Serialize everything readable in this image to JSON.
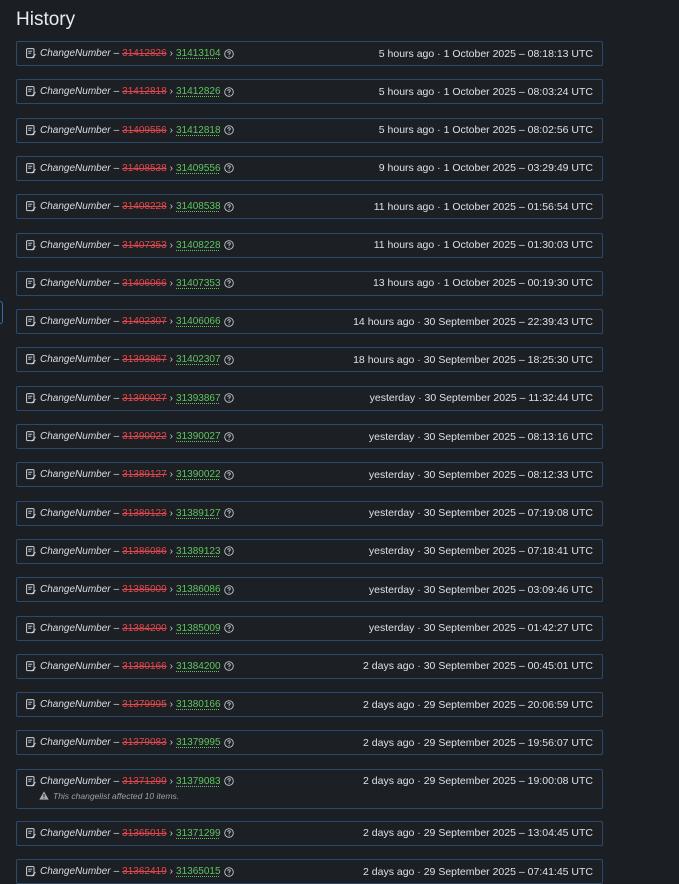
{
  "page": {
    "title": "History"
  },
  "entries": [
    {
      "field": "ChangeNumber",
      "old": "31412826",
      "new": "31413104",
      "time": "5 hours ago · 1 October 2025 – 08:18:13 UTC"
    },
    {
      "field": "ChangeNumber",
      "old": "31412818",
      "new": "31412826",
      "time": "5 hours ago · 1 October 2025 – 08:03:24 UTC"
    },
    {
      "field": "ChangeNumber",
      "old": "31409556",
      "new": "31412818",
      "time": "5 hours ago · 1 October 2025 – 08:02:56 UTC"
    },
    {
      "field": "ChangeNumber",
      "old": "31408538",
      "new": "31409556",
      "time": "9 hours ago · 1 October 2025 – 03:29:49 UTC"
    },
    {
      "field": "ChangeNumber",
      "old": "31408228",
      "new": "31408538",
      "time": "11 hours ago · 1 October 2025 – 01:56:54 UTC"
    },
    {
      "field": "ChangeNumber",
      "old": "31407353",
      "new": "31408228",
      "time": "11 hours ago · 1 October 2025 – 01:30:03 UTC"
    },
    {
      "field": "ChangeNumber",
      "old": "31406066",
      "new": "31407353",
      "time": "13 hours ago · 1 October 2025 – 00:19:30 UTC"
    },
    {
      "field": "ChangeNumber",
      "old": "31402307",
      "new": "31406066",
      "time": "14 hours ago · 30 September 2025 – 22:39:43 UTC"
    },
    {
      "field": "ChangeNumber",
      "old": "31393867",
      "new": "31402307",
      "time": "18 hours ago · 30 September 2025 – 18:25:30 UTC"
    },
    {
      "field": "ChangeNumber",
      "old": "31390027",
      "new": "31393867",
      "time": "yesterday · 30 September 2025 – 11:32:44 UTC"
    },
    {
      "field": "ChangeNumber",
      "old": "31390022",
      "new": "31390027",
      "time": "yesterday · 30 September 2025 – 08:13:16 UTC"
    },
    {
      "field": "ChangeNumber",
      "old": "31389127",
      "new": "31390022",
      "time": "yesterday · 30 September 2025 – 08:12:33 UTC"
    },
    {
      "field": "ChangeNumber",
      "old": "31389123",
      "new": "31389127",
      "time": "yesterday · 30 September 2025 – 07:19:08 UTC"
    },
    {
      "field": "ChangeNumber",
      "old": "31386086",
      "new": "31389123",
      "time": "yesterday · 30 September 2025 – 07:18:41 UTC"
    },
    {
      "field": "ChangeNumber",
      "old": "31385009",
      "new": "31386086",
      "time": "yesterday · 30 September 2025 – 03:09:46 UTC"
    },
    {
      "field": "ChangeNumber",
      "old": "31384200",
      "new": "31385009",
      "time": "yesterday · 30 September 2025 – 01:42:27 UTC"
    },
    {
      "field": "ChangeNumber",
      "old": "31380166",
      "new": "31384200",
      "time": "2 days ago · 30 September 2025 – 00:45:01 UTC"
    },
    {
      "field": "ChangeNumber",
      "old": "31379995",
      "new": "31380166",
      "time": "2 days ago · 29 September 2025 – 20:06:59 UTC"
    },
    {
      "field": "ChangeNumber",
      "old": "31379083",
      "new": "31379995",
      "time": "2 days ago · 29 September 2025 – 19:56:07 UTC"
    },
    {
      "field": "ChangeNumber",
      "old": "31371299",
      "new": "31379083",
      "time": "2 days ago · 29 September 2025 – 19:00:08 UTC",
      "warning": "This changelist affected 10 items."
    },
    {
      "field": "ChangeNumber",
      "old": "31365015",
      "new": "31371299",
      "time": "2 days ago · 29 September 2025 – 13:04:45 UTC"
    },
    {
      "field": "ChangeNumber",
      "old": "31362419",
      "new": "31365015",
      "time": "2 days ago · 29 September 2025 – 07:41:45 UTC"
    }
  ],
  "icons": {
    "entry": "doc-edit-icon",
    "info": "info-circle-icon",
    "warning": "warning-triangle-icon"
  },
  "colors": {
    "background": "#1b1e23",
    "border": "#2a4a6b",
    "old_value": "#e0474c",
    "new_value": "#5ec45e"
  }
}
